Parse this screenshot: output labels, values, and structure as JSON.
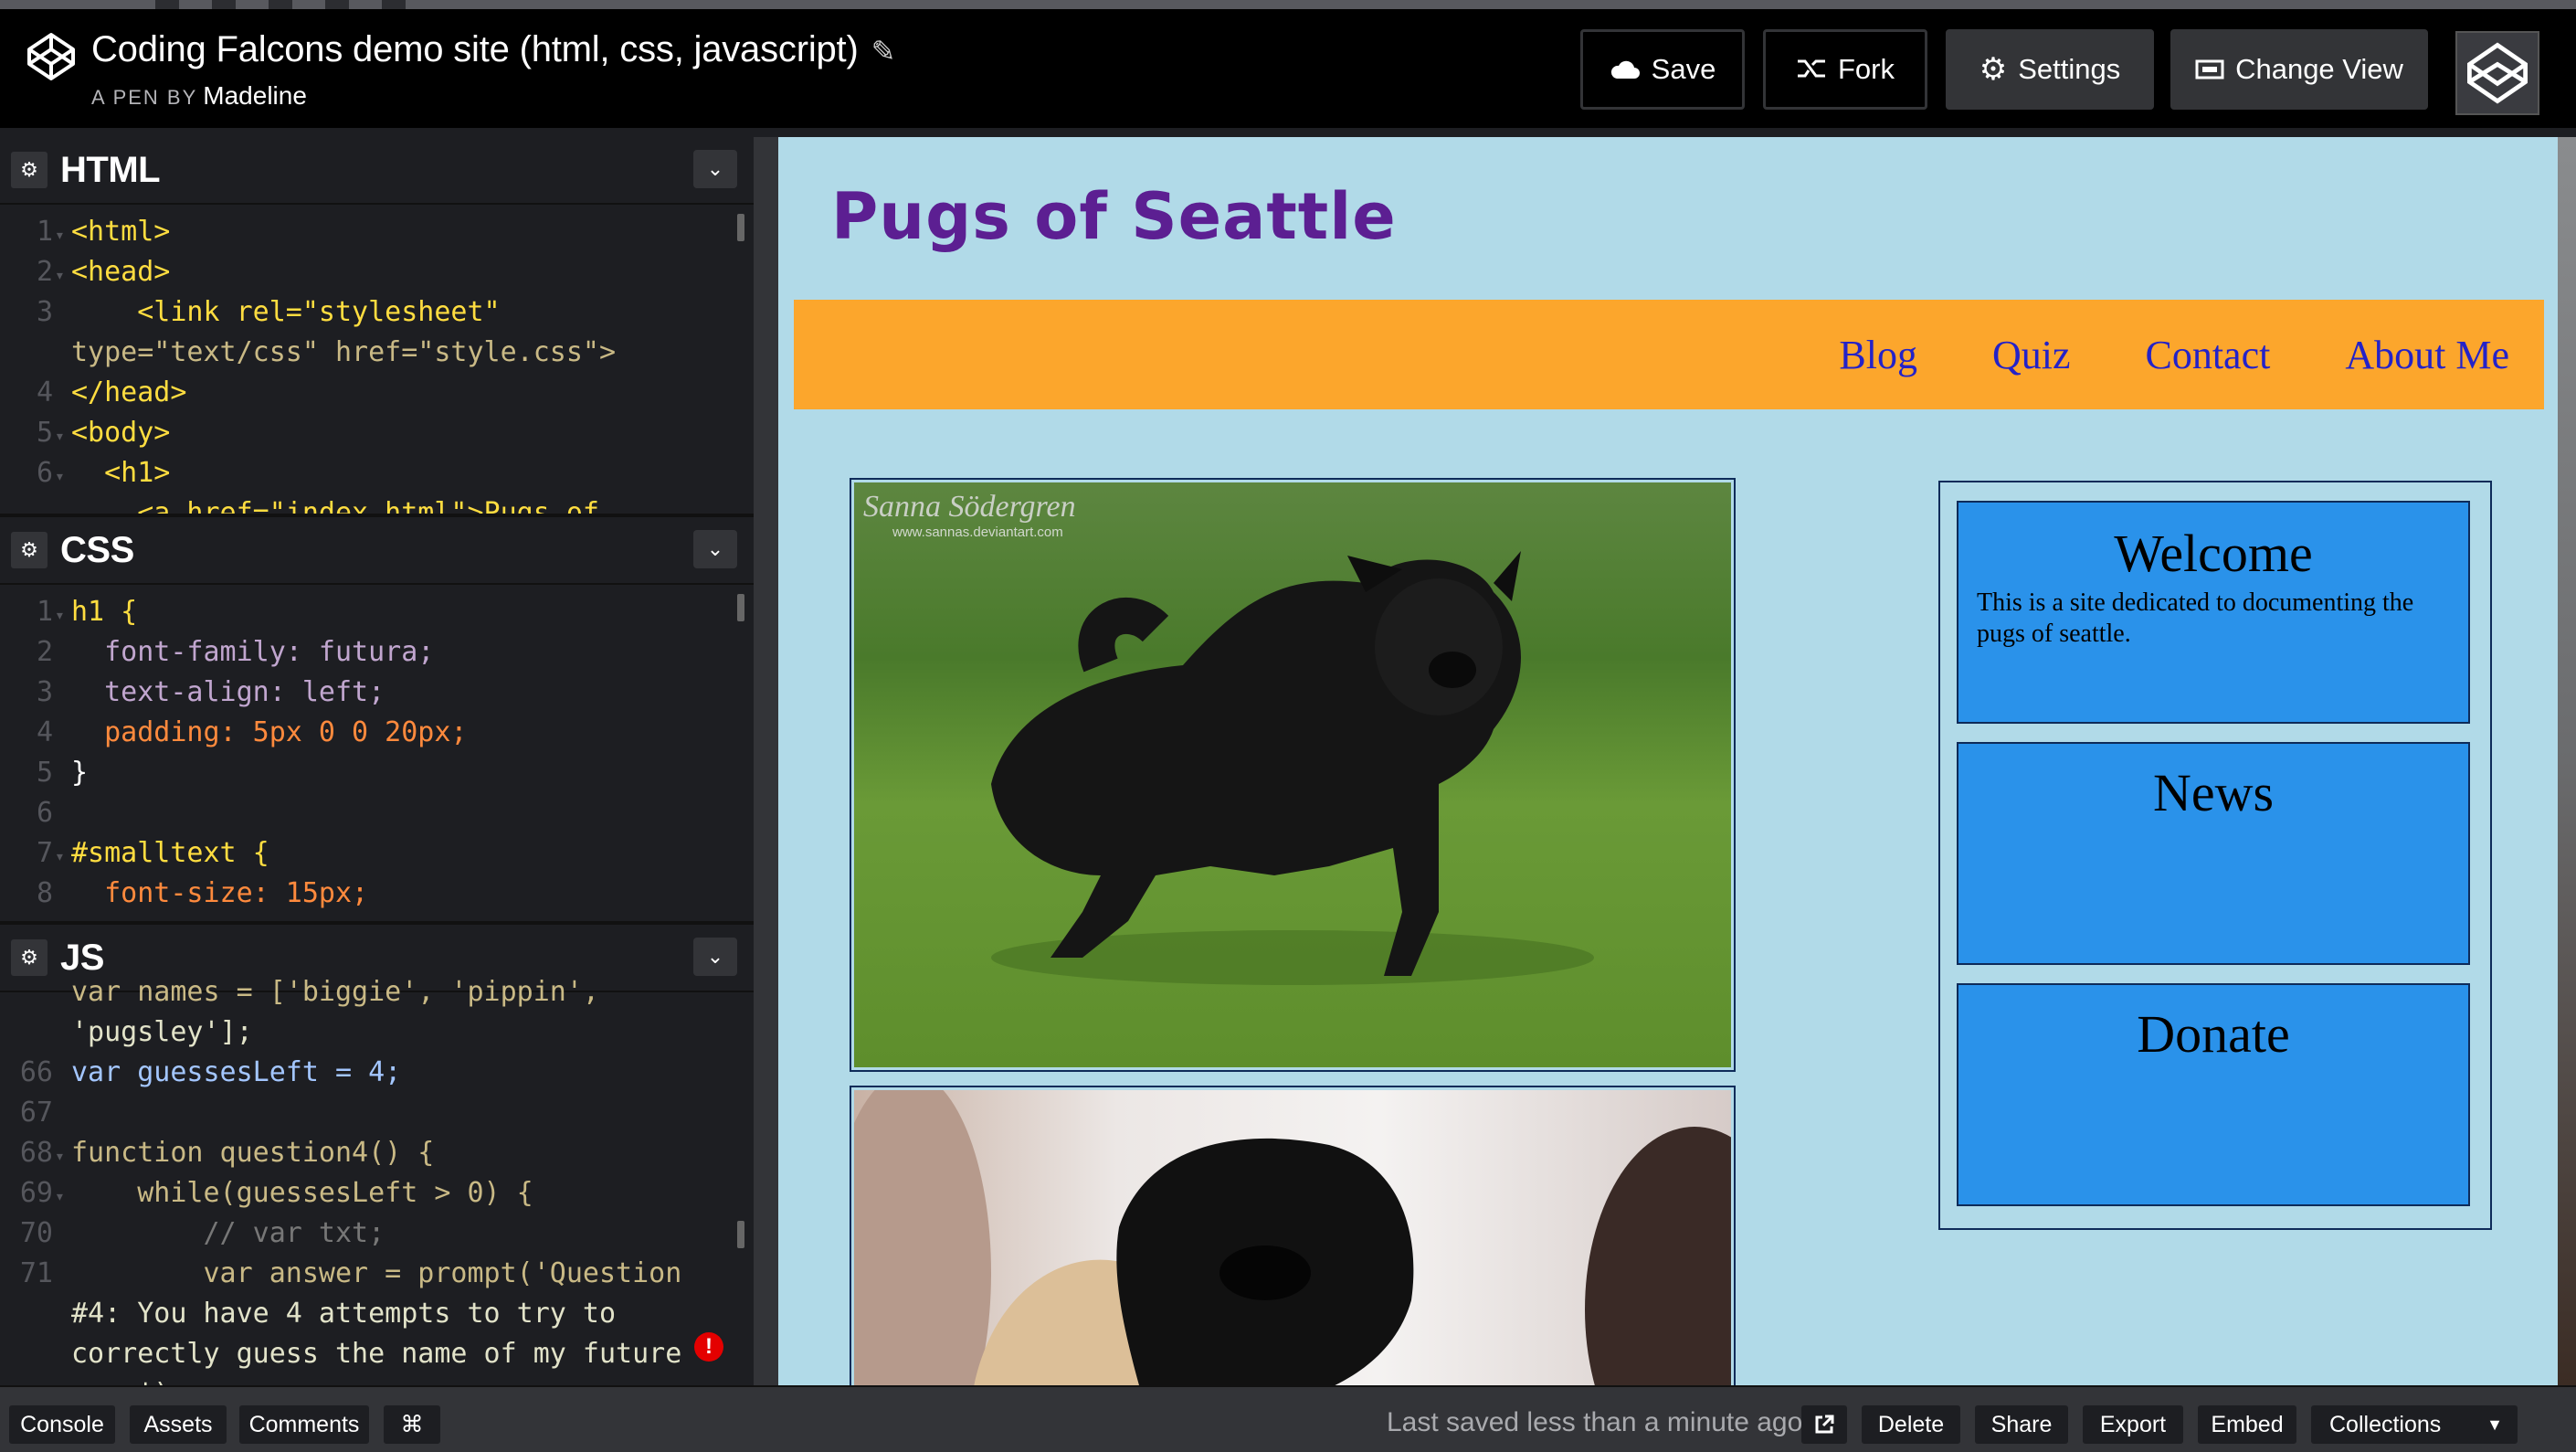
{
  "header": {
    "pen_title": "Coding Falcons demo site (html, css, javascript)",
    "pen_by_label": "A PEN BY",
    "author": "Madeline",
    "buttons": {
      "save": "Save",
      "fork": "Fork",
      "settings": "Settings",
      "change_view": "Change View"
    }
  },
  "panes": {
    "html": {
      "title": "HTML",
      "lines": [
        {
          "n": "1",
          "code": "<html>"
        },
        {
          "n": "2",
          "code": "<head>"
        },
        {
          "n": "3",
          "code": "    <link rel=\"stylesheet\""
        },
        {
          "n": "",
          "code": "type=\"text/css\" href=\"style.css\">"
        },
        {
          "n": "4",
          "code": "</head>"
        },
        {
          "n": "5",
          "code": "<body>"
        },
        {
          "n": "6",
          "code": "  <h1>"
        },
        {
          "n": "",
          "code": "    <a href=\"index.html\">Pugs of"
        }
      ]
    },
    "css": {
      "title": "CSS",
      "lines": [
        {
          "n": "1",
          "code": "h1 {"
        },
        {
          "n": "2",
          "code": "  font-family: futura;"
        },
        {
          "n": "3",
          "code": "  text-align: left;"
        },
        {
          "n": "4",
          "code": "  padding: 5px 0 0 20px;"
        },
        {
          "n": "5",
          "code": "}"
        },
        {
          "n": "6",
          "code": ""
        },
        {
          "n": "7",
          "code": "#smalltext {"
        },
        {
          "n": "8",
          "code": "  font-size: 15px;"
        }
      ]
    },
    "js": {
      "title": "JS",
      "lines": [
        {
          "n": "",
          "code": "var names = ['biggie', 'pippin',"
        },
        {
          "n": "",
          "code": "'pugsley'];"
        },
        {
          "n": "66",
          "code": "var guessesLeft = 4;"
        },
        {
          "n": "67",
          "code": ""
        },
        {
          "n": "68",
          "code": "function question4() {"
        },
        {
          "n": "69",
          "code": "    while(guessesLeft > 0) {"
        },
        {
          "n": "70",
          "code": "        // var txt;"
        },
        {
          "n": "71",
          "code": "        var answer = prompt('Question"
        },
        {
          "n": "",
          "code": "#4: You have 4 attempts to try to"
        },
        {
          "n": "",
          "code": "correctly guess the name of my future"
        },
        {
          "n": "",
          "code": "pug.');"
        }
      ]
    }
  },
  "preview": {
    "site_title": "Pugs of Seattle",
    "nav": [
      "Blog",
      "Quiz",
      "Contact",
      "About Me"
    ],
    "photo1_watermark": "Sanna Södergren",
    "photo1_watermark_url": "www.sannas.deviantart.com",
    "sidebar": {
      "welcome_title": "Welcome",
      "welcome_text": "This is a site dedicated to documenting the pugs of seattle.",
      "news_title": "News",
      "donate_title": "Donate"
    }
  },
  "footer": {
    "console": "Console",
    "assets": "Assets",
    "comments": "Comments",
    "cmd": "⌘",
    "saved_status": "Last saved less than a minute ago",
    "delete": "Delete",
    "share": "Share",
    "export": "Export",
    "embed": "Embed",
    "collections": "Collections"
  },
  "colors": {
    "preview_bg": "#b1dae8",
    "nav_bg": "#fca62c",
    "title_purple": "#5c1f92",
    "sidebar_box": "#2a92ea"
  }
}
